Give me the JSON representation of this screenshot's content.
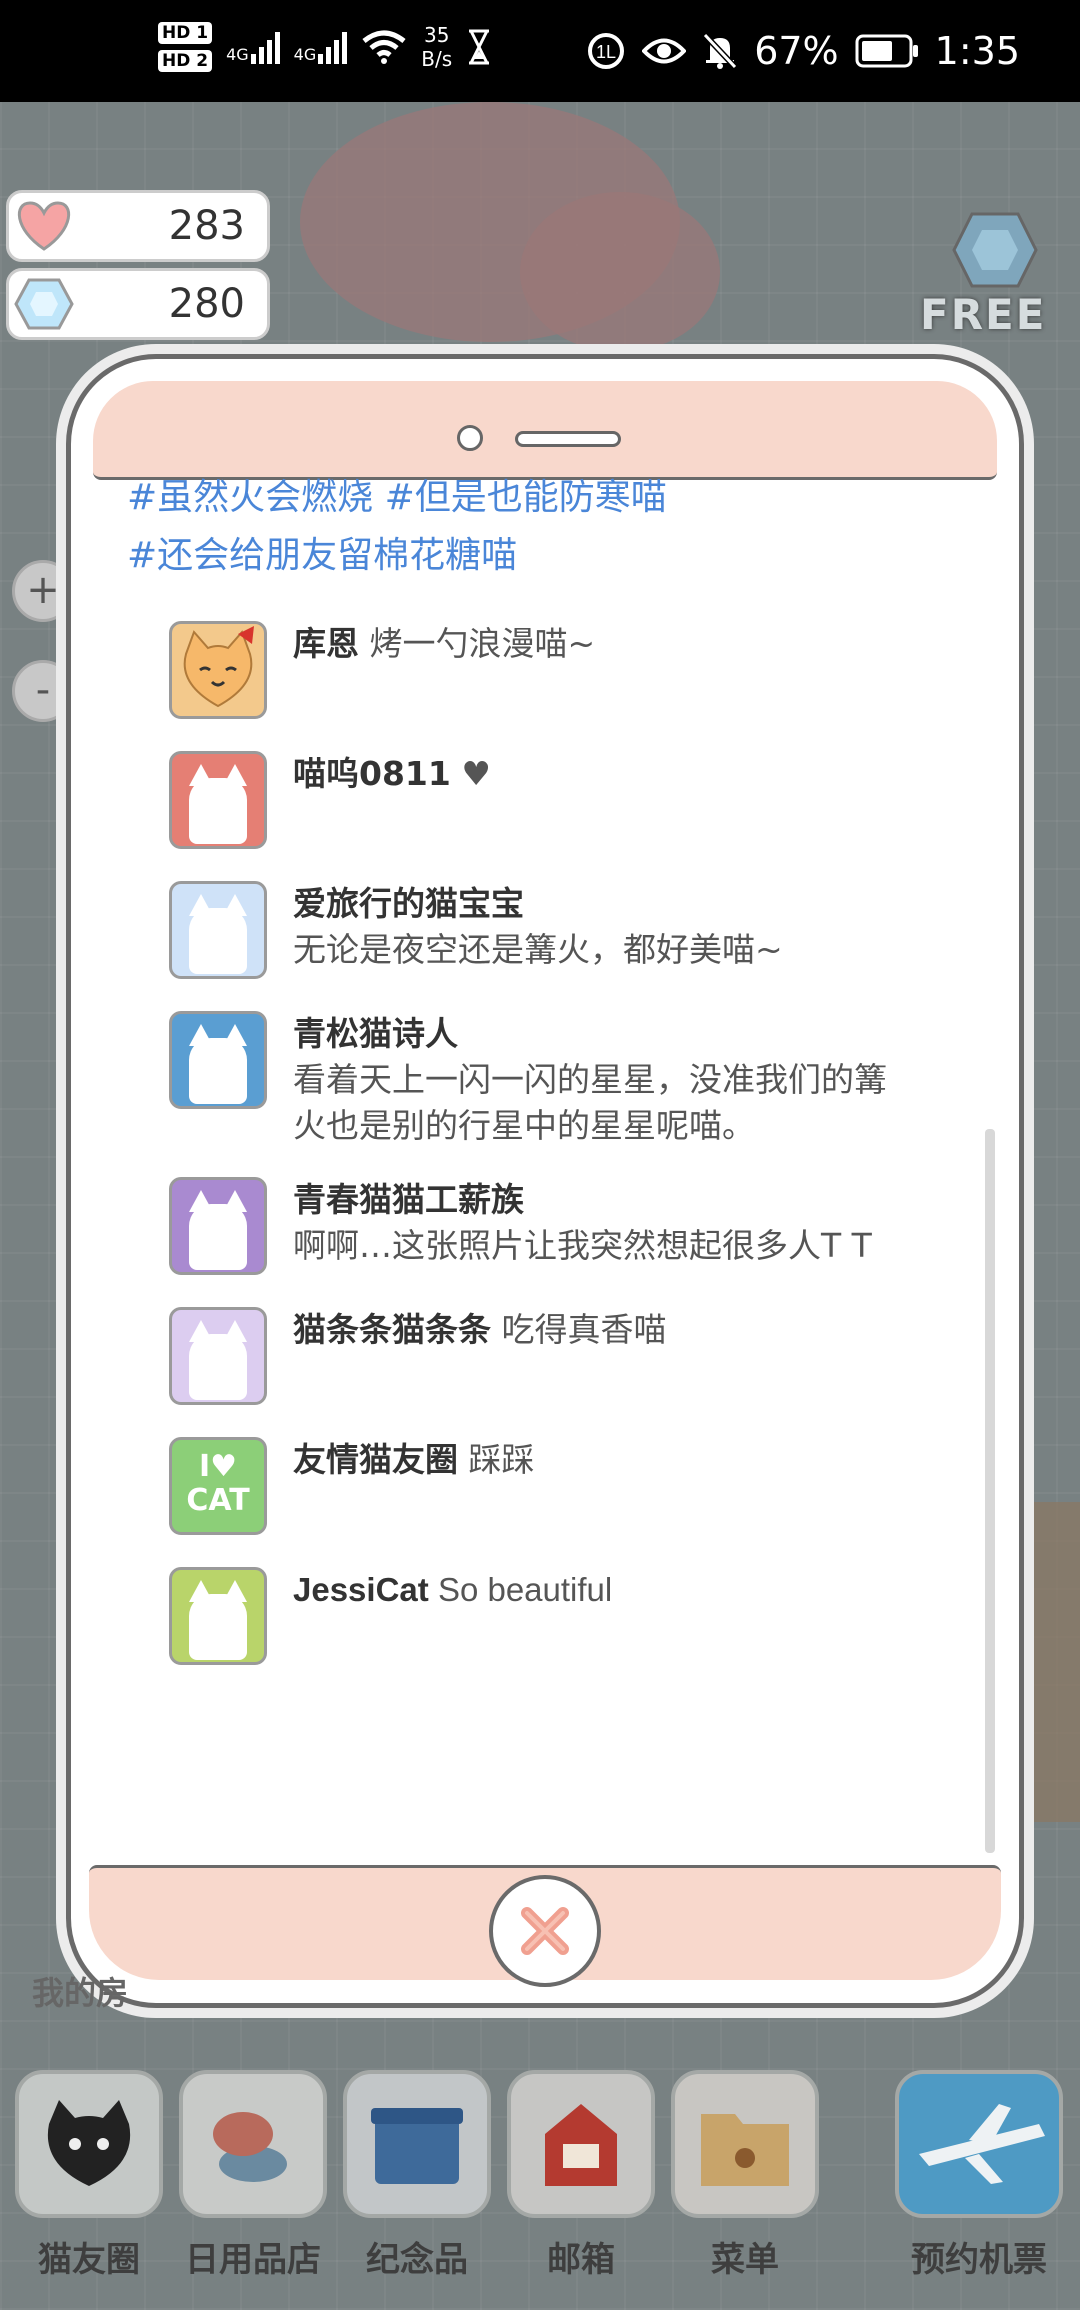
{
  "status_bar": {
    "hd1": "HD 1",
    "hd2": "HD 2",
    "net1": "4G",
    "net2": "4G",
    "speed_value": "35",
    "speed_unit": "B/s",
    "battery": "67%",
    "time": "1:35"
  },
  "counters": {
    "hearts": "283",
    "gems": "280"
  },
  "free_label": "FREE",
  "zoom": {
    "in": "+",
    "out": "-"
  },
  "post": {
    "tag_line_1": "#虽然火会燃烧 #但是也能防寒喵",
    "tag_line_2": "#还会给朋友留棉花糖喵"
  },
  "comments": [
    {
      "name": "库恩",
      "text": "烤一勺浪漫喵~",
      "avatar_color": "#f3c98c"
    },
    {
      "name": "喵呜0811",
      "text": "♥",
      "avatar_color": "#e57f74"
    },
    {
      "name": "爱旅行的猫宝宝",
      "text": "无论是夜空还是篝火，都好美喵~",
      "avatar_color": "#cfe2f8"
    },
    {
      "name": "青松猫诗人",
      "text": "看着天上一闪一闪的星星，没准我们的篝",
      "text2": "火也是别的行星中的星星呢喵。",
      "avatar_color": "#5a9ed2"
    },
    {
      "name": "青春猫猫工薪族",
      "text": "啊啊…这张照片让我突然想起很多人T T",
      "avatar_color": "#a98ad0"
    },
    {
      "name": "猫条条猫条条",
      "text": "吃得真香喵",
      "avatar_color": "#dccdf0"
    },
    {
      "name": "友情猫友圈",
      "text": "踩踩",
      "avatar_color": "#8ccf78",
      "badge_top": "I♥",
      "badge_bottom": "CAT"
    },
    {
      "name": "JessiCat",
      "text": "So beautiful",
      "avatar_color": "#b9d46a"
    }
  ],
  "partial_label": "我的房",
  "dock": [
    {
      "label": "猫友圈"
    },
    {
      "label": "日用品店"
    },
    {
      "label": "纪念品"
    },
    {
      "label": "邮箱"
    },
    {
      "label": "菜单"
    },
    {
      "label": "预约机票"
    }
  ],
  "colors": {
    "tag_blue": "#4a86d8",
    "phone_pink": "#f8d8cc",
    "close_x": "#f0a090"
  }
}
